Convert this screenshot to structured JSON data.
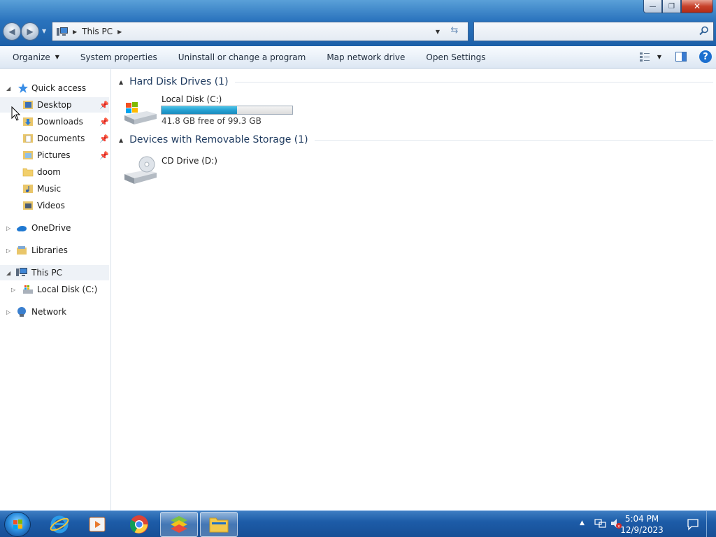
{
  "window": {
    "controls": {
      "minimize": "—",
      "maximize": "❐",
      "close": "✕"
    }
  },
  "address": {
    "path": "This PC",
    "search_placeholder": ""
  },
  "toolbar": {
    "organize": "Organize",
    "system_properties": "System properties",
    "uninstall": "Uninstall or change a program",
    "map_drive": "Map network drive",
    "open_settings": "Open Settings",
    "help": "?"
  },
  "nav": {
    "quick_access": "Quick access",
    "quick_items": [
      {
        "label": "Desktop",
        "icon": "desktop-folder-icon",
        "pinned": true
      },
      {
        "label": "Downloads",
        "icon": "downloads-folder-icon",
        "pinned": true
      },
      {
        "label": "Documents",
        "icon": "documents-folder-icon",
        "pinned": true
      },
      {
        "label": "Pictures",
        "icon": "pictures-folder-icon",
        "pinned": true
      },
      {
        "label": "doom",
        "icon": "folder-icon",
        "pinned": false
      },
      {
        "label": "Music",
        "icon": "music-folder-icon",
        "pinned": false
      },
      {
        "label": "Videos",
        "icon": "videos-folder-icon",
        "pinned": false
      }
    ],
    "onedrive": "OneDrive",
    "libraries": "Libraries",
    "this_pc": "This PC",
    "local_disk": "Local Disk (C:)",
    "network": "Network"
  },
  "content": {
    "groups": [
      {
        "title": "Hard Disk Drives (1)",
        "items": [
          {
            "name": "Local Disk (C:)",
            "free_text": "41.8 GB free of 99.3 GB",
            "used_fraction": 0.58
          }
        ]
      },
      {
        "title": "Devices with Removable Storage (1)",
        "items": [
          {
            "name": "CD Drive (D:)"
          }
        ]
      }
    ]
  },
  "taskbar": {
    "apps": [
      "internet-explorer-icon",
      "media-player-icon",
      "chrome-icon",
      "bluestacks-icon",
      "file-explorer-icon"
    ],
    "time": "5:04 PM",
    "date": "12/9/2023"
  },
  "colors": {
    "titlebar": "#2a73bd",
    "drive_fill": "#26a1d3",
    "taskbar": "#1d5ca8"
  }
}
